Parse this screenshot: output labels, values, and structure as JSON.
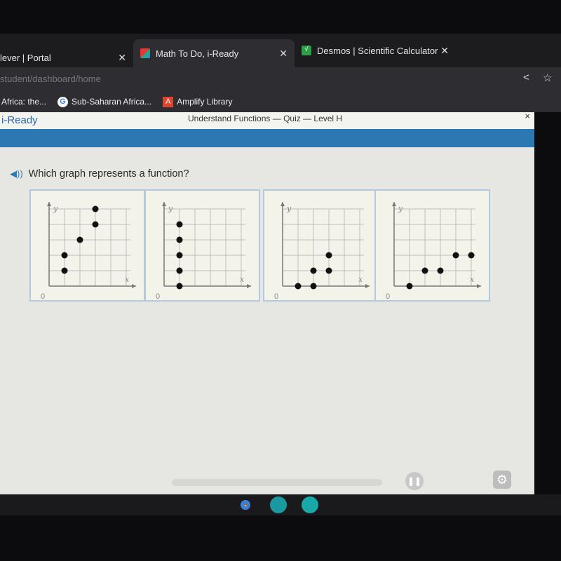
{
  "browser": {
    "tabs": [
      {
        "label": "lever | Portal",
        "active": false
      },
      {
        "label": "Math To Do, i-Ready",
        "active": true
      },
      {
        "label": "Desmos | Scientific Calculator",
        "active": false
      }
    ],
    "new_tab": "+",
    "url": "student/dashboard/home",
    "bookmarks": [
      {
        "label": "Africa: the..."
      },
      {
        "label": "Sub-Saharan Africa...",
        "icon": "G"
      },
      {
        "label": "Amplify Library",
        "icon": "A"
      }
    ]
  },
  "app": {
    "logo": "i-Ready",
    "title": "Understand Functions — Quiz — Level H",
    "close": "×",
    "question": "Which graph represents a function?",
    "axis": {
      "x": "x",
      "y": "y",
      "origin": "0"
    }
  },
  "chart_data": [
    {
      "type": "scatter",
      "xlim": [
        0,
        5
      ],
      "ylim": [
        0,
        5
      ],
      "grid": true,
      "points": [
        [
          1,
          1
        ],
        [
          1,
          2
        ],
        [
          2,
          3
        ],
        [
          3,
          4
        ],
        [
          3,
          5
        ]
      ]
    },
    {
      "type": "scatter",
      "xlim": [
        0,
        5
      ],
      "ylim": [
        0,
        5
      ],
      "grid": true,
      "points": [
        [
          1,
          0
        ],
        [
          1,
          1
        ],
        [
          1,
          2
        ],
        [
          1,
          3
        ],
        [
          1,
          4
        ]
      ]
    },
    {
      "type": "scatter",
      "xlim": [
        0,
        5
      ],
      "ylim": [
        0,
        5
      ],
      "grid": true,
      "points": [
        [
          1,
          0
        ],
        [
          2,
          0
        ],
        [
          2,
          1
        ],
        [
          3,
          1
        ],
        [
          3,
          2
        ]
      ]
    },
    {
      "type": "scatter",
      "xlim": [
        0,
        5
      ],
      "ylim": [
        0,
        5
      ],
      "grid": true,
      "points": [
        [
          1,
          0
        ],
        [
          2,
          1
        ],
        [
          3,
          1
        ],
        [
          4,
          2
        ],
        [
          5,
          2
        ]
      ]
    }
  ],
  "colors": {
    "accent": "#2c78b2",
    "dot": "#111111"
  }
}
